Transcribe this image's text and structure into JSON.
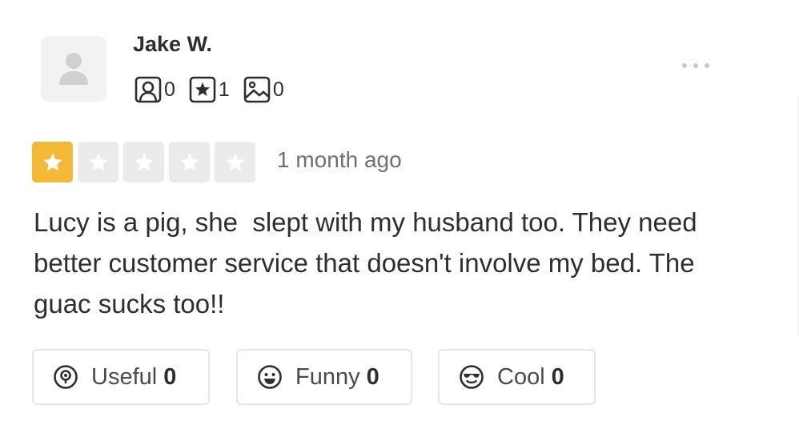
{
  "user": {
    "name": "Jake W.",
    "stats": [
      {
        "icon": "friends-icon",
        "count": "0"
      },
      {
        "icon": "reviews-star-icon",
        "count": "1"
      },
      {
        "icon": "photos-icon",
        "count": "0"
      }
    ]
  },
  "review": {
    "rating": 1,
    "rating_max": 5,
    "date": "1 month ago",
    "text": "Lucy is a pig, she  slept with my husband too. They need better customer service that doesn't involve my bed. The guac sucks too!!"
  },
  "reactions": [
    {
      "icon": "useful-icon",
      "label": "Useful",
      "count": "0"
    },
    {
      "icon": "funny-icon",
      "label": "Funny",
      "count": "0"
    },
    {
      "icon": "cool-icon",
      "label": "Cool",
      "count": "0"
    }
  ],
  "colors": {
    "star_active": "#f5b938",
    "star_inactive": "#ebebeb",
    "text_primary": "#2d2e2f",
    "text_secondary": "#6e7072"
  }
}
